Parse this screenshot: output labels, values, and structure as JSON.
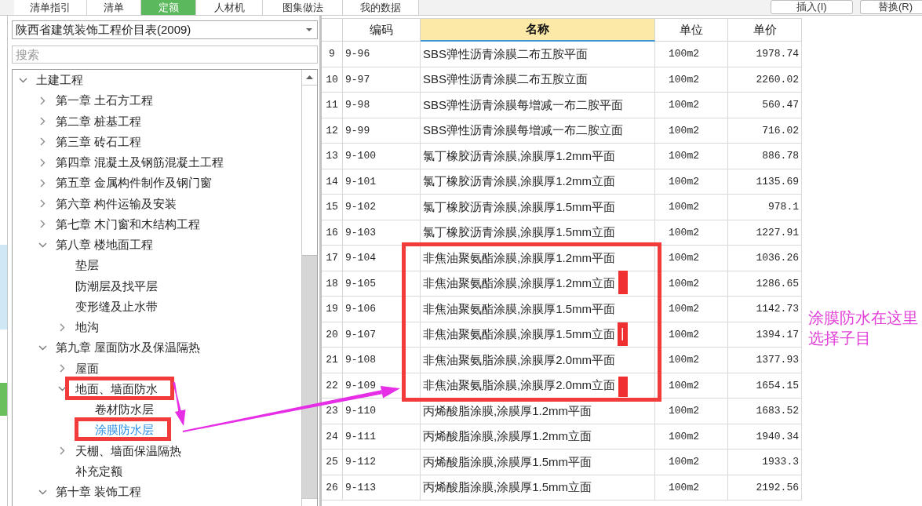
{
  "toolbar": {
    "tabs": [
      {
        "label": "清单指引",
        "selected": false
      },
      {
        "label": "清单",
        "selected": false
      },
      {
        "label": "定额",
        "selected": true
      },
      {
        "label": "人材机",
        "selected": false
      },
      {
        "label": "图集做法",
        "selected": false
      },
      {
        "label": "我的数据",
        "selected": false
      }
    ],
    "buttons": [
      "插入(I)",
      "替换(R)"
    ]
  },
  "library_dropdown": {
    "value": "陕西省建筑装饰工程价目表(2009)"
  },
  "search": {
    "placeholder": "搜索"
  },
  "tree": [
    {
      "label": "土建工程",
      "expanded": true,
      "selected": false,
      "children": [
        {
          "label": "第一章 土石方工程",
          "expanded": false,
          "selected": false
        },
        {
          "label": "第二章 桩基工程",
          "expanded": false,
          "selected": false
        },
        {
          "label": "第三章 砖石工程",
          "expanded": false,
          "selected": false
        },
        {
          "label": "第四章 混凝土及钢筋混凝土工程",
          "expanded": false,
          "selected": false
        },
        {
          "label": "第五章 金属构件制作及钢门窗",
          "expanded": false,
          "selected": false
        },
        {
          "label": "第六章 构件运输及安装",
          "expanded": false,
          "selected": false
        },
        {
          "label": "第七章 木门窗和木结构工程",
          "expanded": false,
          "selected": false
        },
        {
          "label": "第八章 楼地面工程",
          "expanded": true,
          "selected": false,
          "children": [
            {
              "label": "垫层",
              "selected": false
            },
            {
              "label": "防潮层及找平层",
              "selected": false
            },
            {
              "label": "变形缝及止水带",
              "selected": false
            },
            {
              "label": "地沟",
              "expanded": false,
              "selected": false
            }
          ]
        },
        {
          "label": "第九章 屋面防水及保温隔热",
          "expanded": true,
          "selected": false,
          "children": [
            {
              "label": "屋面",
              "expanded": false,
              "selected": false
            },
            {
              "label": "地面、墙面防水",
              "expanded": true,
              "selected": false,
              "children": [
                {
                  "label": "卷材防水层",
                  "selected": false
                },
                {
                  "label": "涂膜防水层",
                  "selected": true
                }
              ]
            },
            {
              "label": "天棚、墙面保温隔热",
              "expanded": false,
              "selected": false
            },
            {
              "label": "补充定额",
              "selected": false
            }
          ]
        },
        {
          "label": "第十章 装饰工程",
          "expanded": true,
          "selected": false
        }
      ]
    }
  ],
  "table": {
    "columns": [
      {
        "label": "编码",
        "selected": false
      },
      {
        "label": "名称",
        "selected": true
      },
      {
        "label": "单位",
        "selected": false
      },
      {
        "label": "单价",
        "selected": false
      }
    ],
    "rows": [
      {
        "index": "9",
        "code": "9-96",
        "name": "SBS弹性沥青涂膜二布五胺平面",
        "unit": "100m2",
        "price": "1978.74"
      },
      {
        "index": "10",
        "code": "9-97",
        "name": "SBS弹性沥青涂膜二布五胺立面",
        "unit": "100m2",
        "price": "2260.02"
      },
      {
        "index": "11",
        "code": "9-98",
        "name": "SBS弹性沥青涂膜每增减一布二胺平面",
        "unit": "100m2",
        "price": "560.47"
      },
      {
        "index": "12",
        "code": "9-99",
        "name": "SBS弹性沥青涂膜每增减一布二胺立面",
        "unit": "100m2",
        "price": "716.02"
      },
      {
        "index": "13",
        "code": "9-100",
        "name": "氯丁橡胶沥青涂膜,涂膜厚1.2mm平面",
        "unit": "100m2",
        "price": "886.78"
      },
      {
        "index": "14",
        "code": "9-101",
        "name": "氯丁橡胶沥青涂膜,涂膜厚1.2mm立面",
        "unit": "100m2",
        "price": "1135.69"
      },
      {
        "index": "15",
        "code": "9-102",
        "name": "氯丁橡胶沥青涂膜,涂膜厚1.5mm平面",
        "unit": "100m2",
        "price": "978.1"
      },
      {
        "index": "16",
        "code": "9-103",
        "name": "氯丁橡胶沥青涂膜,涂膜厚1.5mm立面",
        "unit": "100m2",
        "price": "1227.91"
      },
      {
        "index": "17",
        "code": "9-104",
        "name": "非焦油聚氨酯涂膜,涂膜厚1.2mm平面",
        "unit": "100m2",
        "price": "1036.26"
      },
      {
        "index": "18",
        "code": "9-105",
        "name": "非焦油聚氨酯涂膜,涂膜厚1.2mm立面",
        "unit": "100m2",
        "price": "1286.65"
      },
      {
        "index": "19",
        "code": "9-106",
        "name": "非焦油聚氨酯涂膜,涂膜厚1.5mm平面",
        "unit": "100m2",
        "price": "1142.73"
      },
      {
        "index": "20",
        "code": "9-107",
        "name": "非焦油聚氨酯涂膜,涂膜厚1.5mm立面",
        "unit": "100m2",
        "price": "1394.17"
      },
      {
        "index": "21",
        "code": "9-108",
        "name": "非焦油聚氨脂涂膜,涂膜厚2.0mm平面",
        "unit": "100m2",
        "price": "1377.93"
      },
      {
        "index": "22",
        "code": "9-109",
        "name": "非焦油聚氨脂涂膜,涂膜厚2.0mm立面",
        "unit": "100m2",
        "price": "1654.15"
      },
      {
        "index": "23",
        "code": "9-110",
        "name": "丙烯酸脂涂膜,涂膜厚1.2mm平面",
        "unit": "100m2",
        "price": "1683.52"
      },
      {
        "index": "24",
        "code": "9-111",
        "name": "丙烯酸脂涂膜,涂膜厚1.2mm立面",
        "unit": "100m2",
        "price": "1940.34"
      },
      {
        "index": "25",
        "code": "9-112",
        "name": "丙烯酸脂涂膜,涂膜厚1.5mm平面",
        "unit": "100m2",
        "price": "1933.3"
      },
      {
        "index": "26",
        "code": "9-113",
        "name": "丙烯酸脂涂膜,涂膜厚1.5mm立面",
        "unit": "100m2",
        "price": "2192.56"
      }
    ]
  },
  "annotation": {
    "note": "涂膜防水在这里选择子目"
  }
}
